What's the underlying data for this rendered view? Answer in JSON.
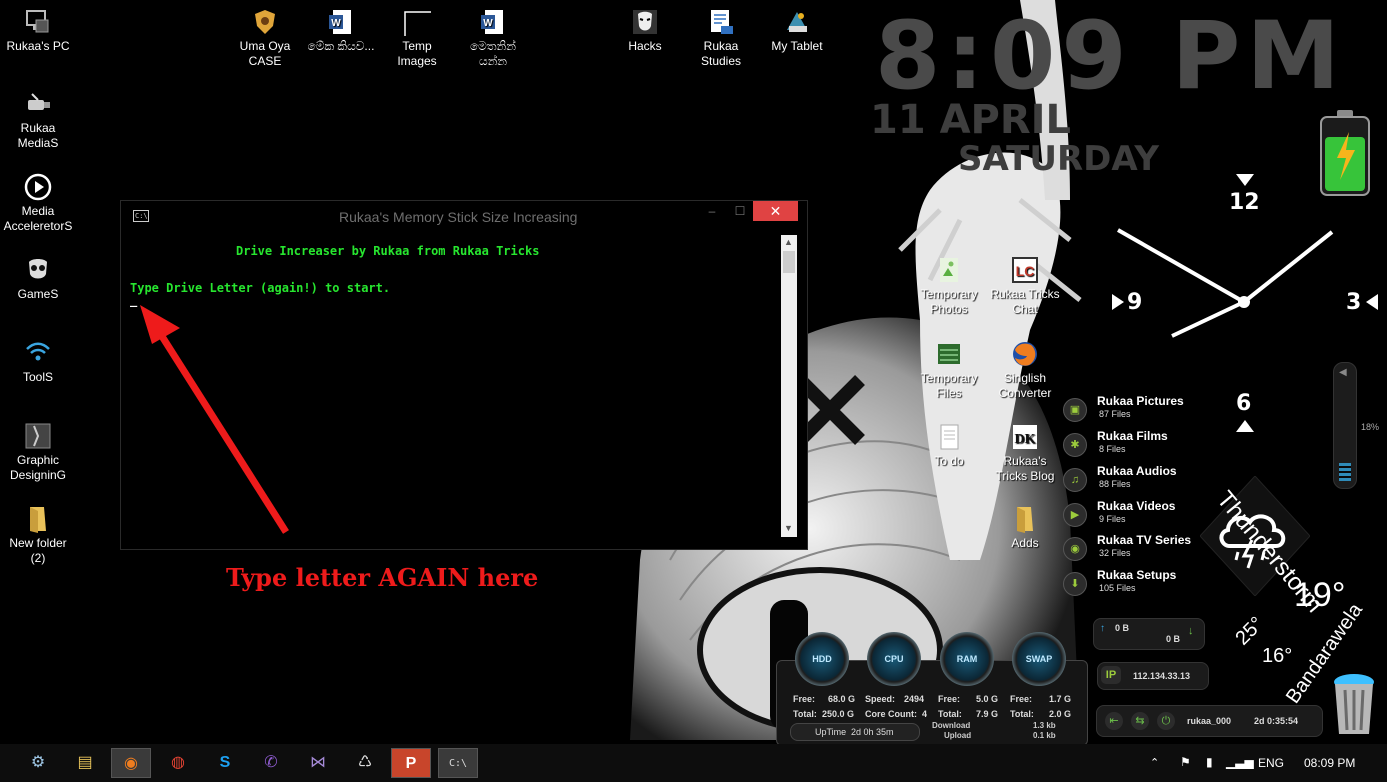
{
  "desktop_icons_left": [
    {
      "label": "Rukaa's PC",
      "icon": "computer-icon"
    },
    {
      "label": "Rukaa MediaS",
      "icon": "usb-icon"
    },
    {
      "label": "Media AcceleretorS",
      "icon": "play-icon"
    },
    {
      "label": "GameS",
      "icon": "mask-icon"
    },
    {
      "label": "ToolS",
      "icon": "wifi-icon"
    },
    {
      "label": "Graphic DesigninG",
      "icon": "graphics-icon"
    },
    {
      "label": "New folder (2)",
      "icon": "folder-icon"
    }
  ],
  "desktop_icons_top": [
    {
      "label": "Uma Oya CASE",
      "icon": "shield-icon"
    },
    {
      "label": "මේක කියව...",
      "icon": "word-doc-icon"
    },
    {
      "label": "Temp Images",
      "icon": "blank-file-icon"
    },
    {
      "label": "මෙතනින් යන්න",
      "icon": "word-doc-icon"
    },
    {
      "label": "Hacks",
      "icon": "anonymous-mask-icon"
    },
    {
      "label": "Rukaa Studies",
      "icon": "document-icon"
    },
    {
      "label": "My Tablet",
      "icon": "tablet-icon"
    }
  ],
  "desktop_icons_middle": [
    {
      "label": "Temporary Photos",
      "icon": "photo-icon"
    },
    {
      "label": "Rukaa Tricks Chat",
      "icon": "chat-icon"
    },
    {
      "label": "Temporary Files",
      "icon": "files-icon"
    },
    {
      "label": "Singlish Converter",
      "icon": "firefox-icon"
    },
    {
      "label": "To do",
      "icon": "text-file-icon"
    },
    {
      "label": "Rukaa's Tricks Blog",
      "icon": "blog-icon"
    },
    {
      "label": "Adds",
      "icon": "folder-icon"
    }
  ],
  "clock_widget": {
    "time": "8:09 PM",
    "date": "11 APRIL",
    "day": "SATURDAY"
  },
  "cmd_window": {
    "title": "Rukaa's Memory Stick Size Increasing",
    "minimize": "–",
    "maximize": "☐",
    "close": "✕",
    "line1": "Drive Increaser by Rukaa from Rukaa Tricks",
    "line2": "Type Drive Letter (again!) to start.",
    "cursor": "_"
  },
  "annotation": "Type letter AGAIN here",
  "analog_clock": {
    "n12": "12",
    "n3": "3",
    "n6": "6",
    "n9": "9"
  },
  "volume": {
    "percent": "18%",
    "level": 0.18
  },
  "fences": [
    {
      "name": "Rukaa Pictures",
      "count": "87 Files",
      "glyph": "▣"
    },
    {
      "name": "Rukaa Films",
      "count": "8 Files",
      "glyph": "✱"
    },
    {
      "name": "Rukaa Audios",
      "count": "88 Files",
      "glyph": "♫"
    },
    {
      "name": "Rukaa Videos",
      "count": "9 Files",
      "glyph": "▶"
    },
    {
      "name": "Rukaa TV Series",
      "count": "32 Files",
      "glyph": "◉"
    },
    {
      "name": "Rukaa Setups",
      "count": "105 Files",
      "glyph": "⬇"
    }
  ],
  "weather": {
    "condition": "Thunderstorm",
    "temp": "19°",
    "high": "25°",
    "low": "16°",
    "location": "Bandarawela"
  },
  "network": {
    "up": "0 B",
    "down": "0 B",
    "ip_label": "IP",
    "ip": "112.134.33.13",
    "user": "rukaa_000",
    "uptime": "2d 0:35:54"
  },
  "sysmon": {
    "gauges": [
      "HDD",
      "CPU",
      "RAM",
      "SWAP"
    ],
    "hdd": {
      "free_label": "Free:",
      "free": "68.0 G",
      "total_label": "Total:",
      "total": "250.0 G"
    },
    "cpu": {
      "speed_label": "Speed:",
      "speed": "2494",
      "cores_label": "Core Count:",
      "cores": "4"
    },
    "ram": {
      "free_label": "Free:",
      "free": "5.0 G",
      "total_label": "Total:",
      "total": "7.9 G"
    },
    "swap": {
      "free_label": "Free:",
      "free": "1.7 G",
      "total_label": "Total:",
      "total": "2.0 G"
    },
    "uptime_label": "UpTime",
    "uptime": "2d 0h 35m",
    "download_label": "Download",
    "download": "1.3 kb",
    "upload_label": "Upload",
    "upload": "0.1 kb"
  },
  "battery": {
    "level": 0.85,
    "color": "#37c43a"
  },
  "taskbar": {
    "apps": [
      {
        "name": "settings-icon",
        "glyph": "⚙"
      },
      {
        "name": "file-explorer-icon",
        "glyph": "▤"
      },
      {
        "name": "firefox-icon",
        "glyph": "◉"
      },
      {
        "name": "chrome-icon",
        "glyph": "◍"
      },
      {
        "name": "skype-icon",
        "glyph": "S"
      },
      {
        "name": "viber-icon",
        "glyph": "✆"
      },
      {
        "name": "visual-studio-icon",
        "glyph": "⋈"
      },
      {
        "name": "recycle-app-icon",
        "glyph": "♺"
      },
      {
        "name": "powerpoint-icon",
        "glyph": "P"
      },
      {
        "name": "cmd-icon",
        "glyph": "C:\\"
      }
    ],
    "language": "ENG",
    "time": "08:09 PM"
  }
}
